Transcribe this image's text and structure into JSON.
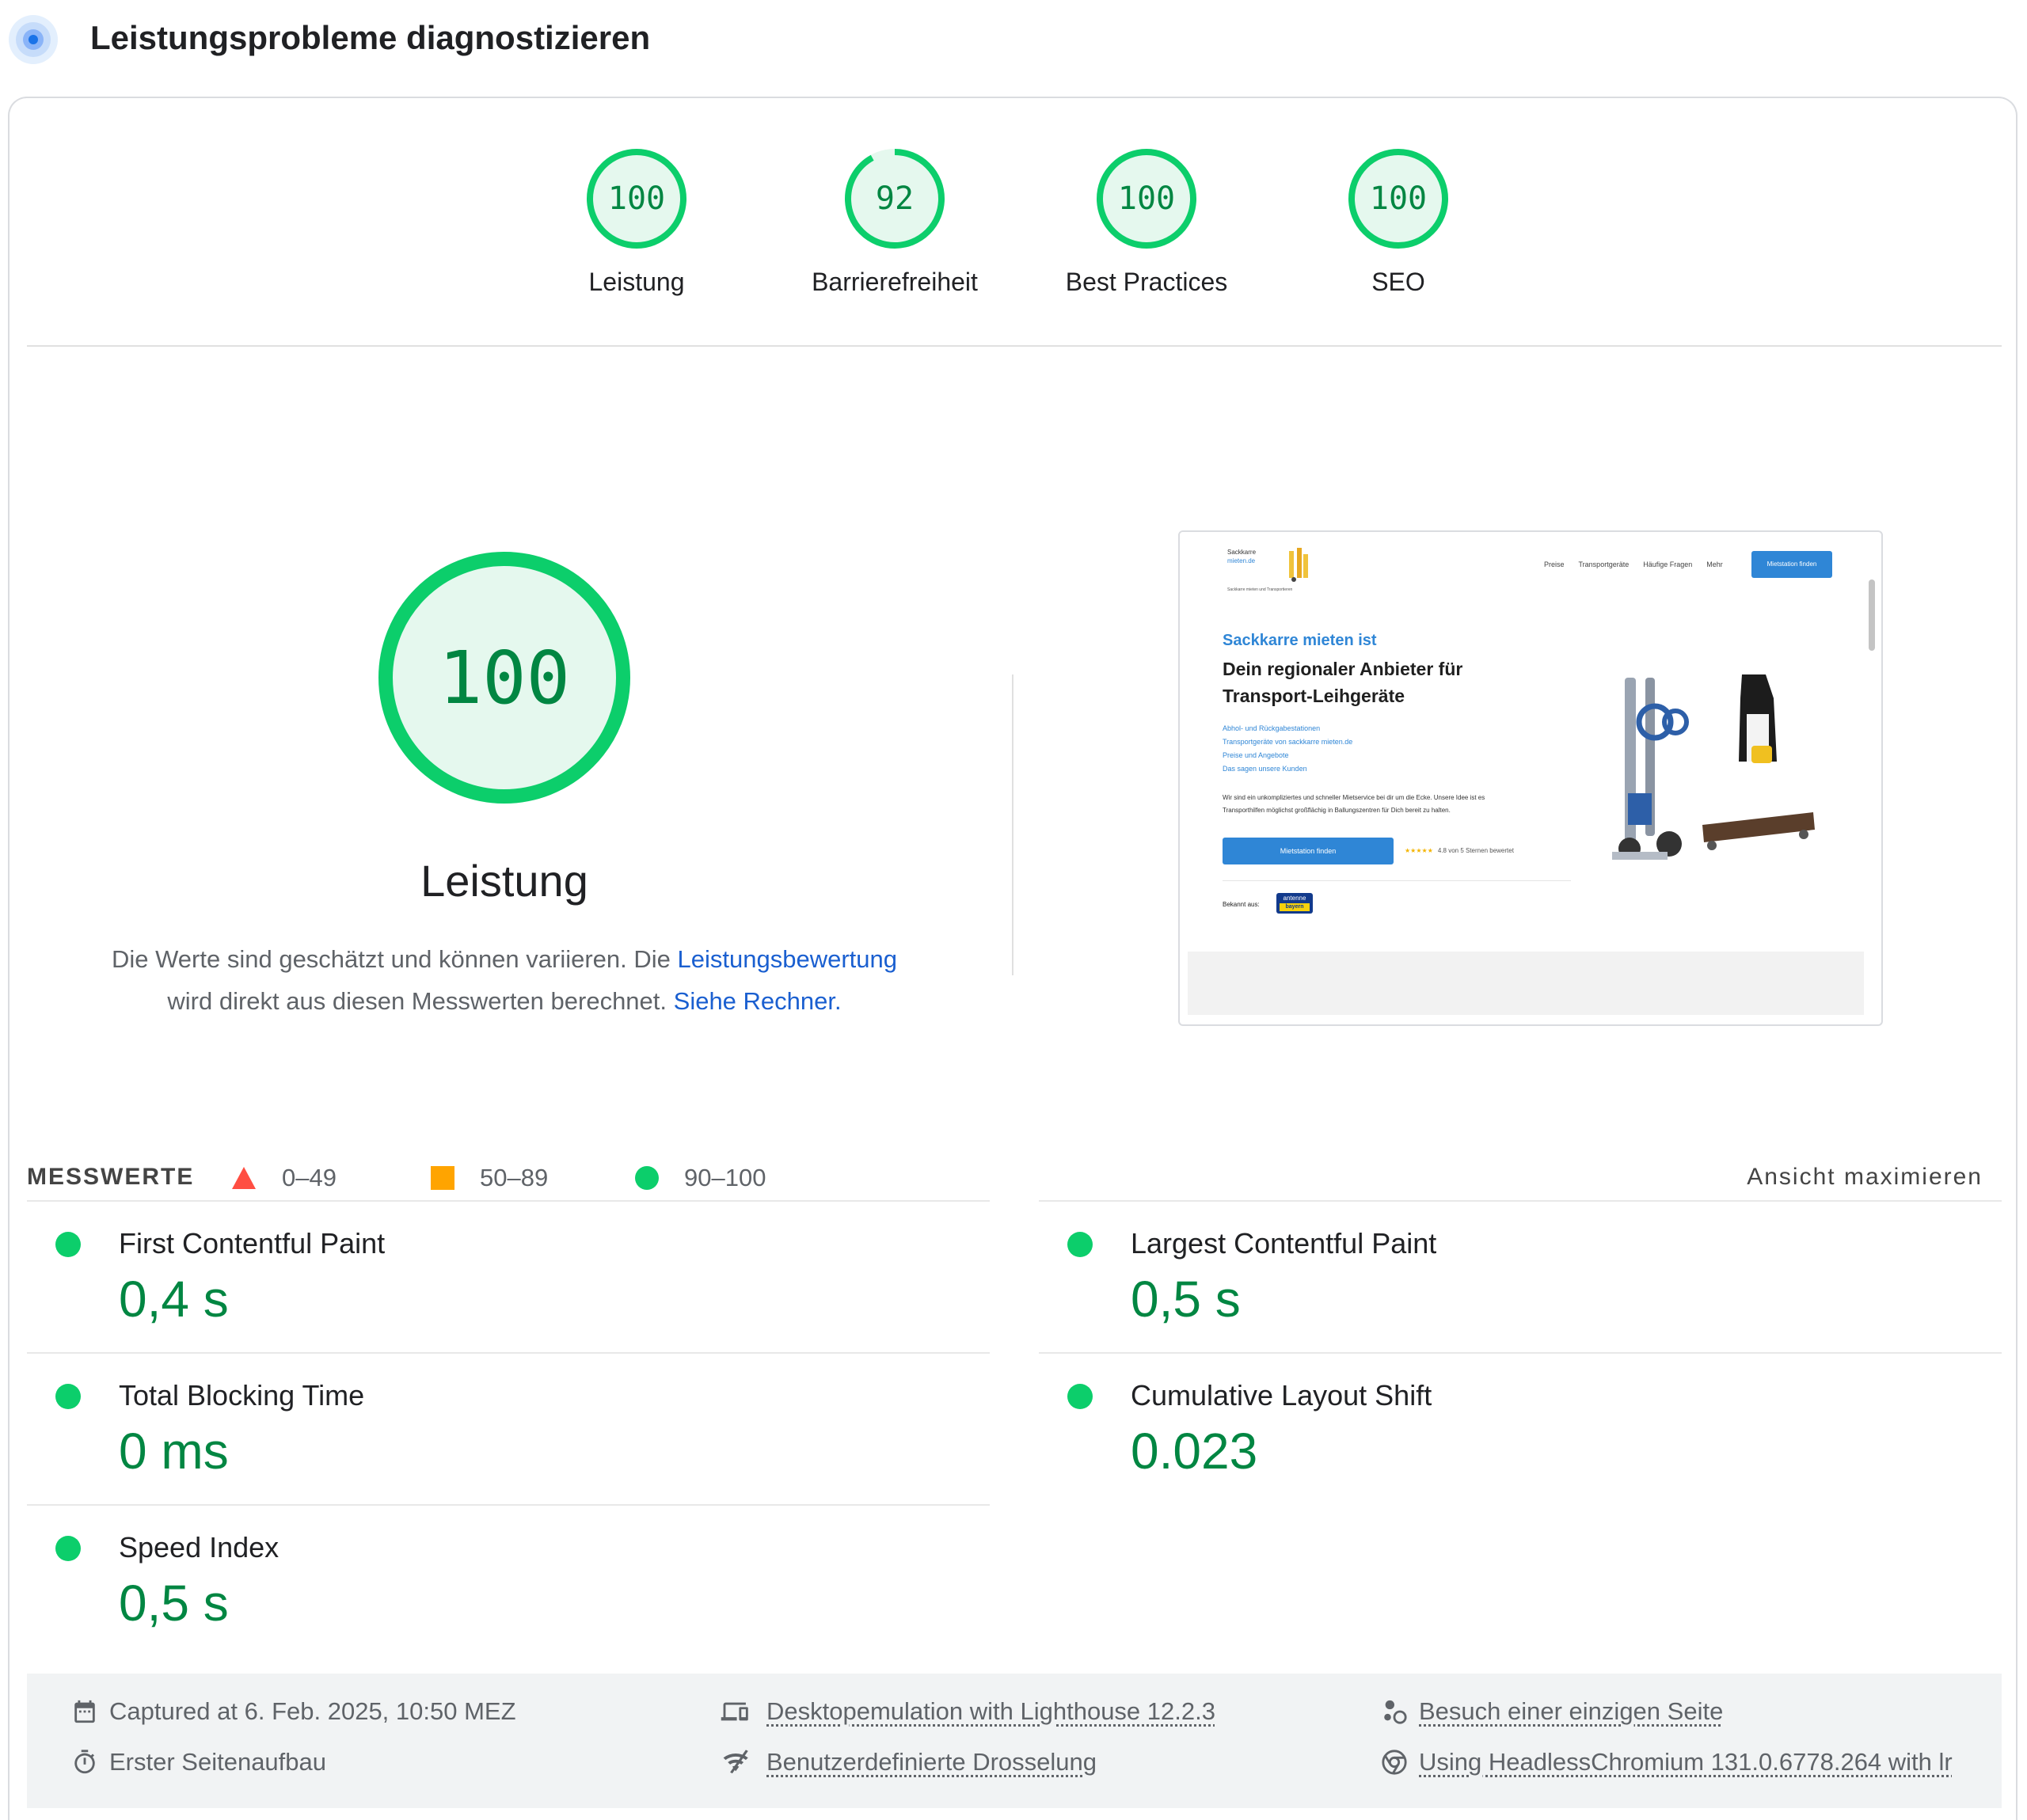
{
  "header": {
    "title": "Leistungsprobleme diagnostizieren",
    "icon": "pagespeed-gauge-icon",
    "accent": "#1a73e8"
  },
  "categories": [
    {
      "score": "100",
      "label": "Leistung",
      "fraction": 1.0
    },
    {
      "score": "92",
      "label": "Barrierefreiheit",
      "fraction": 0.92
    },
    {
      "score": "100",
      "label": "Best Practices",
      "fraction": 1.0
    },
    {
      "score": "100",
      "label": "SEO",
      "fraction": 1.0
    }
  ],
  "performance": {
    "score": "100",
    "fraction": 1.0,
    "title": "Leistung",
    "desc_part1": "Die Werte sind geschätzt und können variieren. Die ",
    "link_scoring": "Leistungsbewertung",
    "desc_part2": " wird direkt aus diesen Messwerten berechnet. ",
    "link_calculator": "Siehe Rechner.",
    "legend": [
      {
        "shape": "triangle",
        "range": "0–49",
        "color": "#ff4e42"
      },
      {
        "shape": "square",
        "range": "50–89",
        "color": "#ffa400"
      },
      {
        "shape": "circle",
        "range": "90–100",
        "color": "#0cce6b"
      }
    ]
  },
  "screenshot": {
    "logo_line1": "Sackkarre",
    "logo_line2": "mieten.de",
    "logo_sub": "Sackkarre mieten und Transportieren",
    "nav": [
      "Preise",
      "Transportgeräte",
      "Häufige Fragen",
      "Mehr"
    ],
    "nav_button": "Mietstation finden",
    "kicker": "Sackkarre mieten ist",
    "headline_1": "Dein regionaler Anbieter für",
    "headline_2": "Transport-Leihgeräte",
    "links": [
      "Abhol- und Rückgabestationen",
      "Transportgeräte von sackkarre mieten.de",
      "Preise und Angebote",
      "Das sagen unsere Kunden"
    ],
    "para_1": "Wir sind ein unkompliziertes und schneller Mietservice bei dir um die Ecke. Unsere Idee ist es",
    "para_2": "Transporthilfen möglichst großflächig in Ballungszentren für Dich bereit zu halten.",
    "cta": "Mietstation finden",
    "stars": "★★★★★",
    "rating": "4.8 von 5 Sternen bewertet",
    "known_from": "Bekannt aus:",
    "antenne_1": "antenne",
    "antenne_2": "bayern"
  },
  "metrics": {
    "title": "MESSWERTE",
    "toggle": "Ansicht maximieren",
    "status_color": "#0cce6b",
    "value_color": "#018642",
    "items": [
      {
        "label": "First Contentful Paint",
        "value": "0,4 s"
      },
      {
        "label": "Largest Contentful Paint",
        "value": "0,5 s"
      },
      {
        "label": "Total Blocking Time",
        "value": "0 ms"
      },
      {
        "label": "Cumulative Layout Shift",
        "value": "0.023"
      },
      {
        "label": "Speed Index",
        "value": "0,5 s"
      }
    ]
  },
  "environment": {
    "captured": "Captured at 6. Feb. 2025, 10:50 MEZ",
    "load": "Erster Seitenaufbau",
    "emulation": "Desktopemulation with Lighthouse 12.2.3",
    "throttling": "Benutzerdefinierte Drosselung",
    "session": "Besuch einer einzigen Seite",
    "browser": "Using HeadlessChromium 131.0.6778.264 with lr",
    "icons": [
      "calendar-icon",
      "timer-icon",
      "devices-icon",
      "network-icon",
      "people-icon",
      "chrome-icon"
    ]
  }
}
